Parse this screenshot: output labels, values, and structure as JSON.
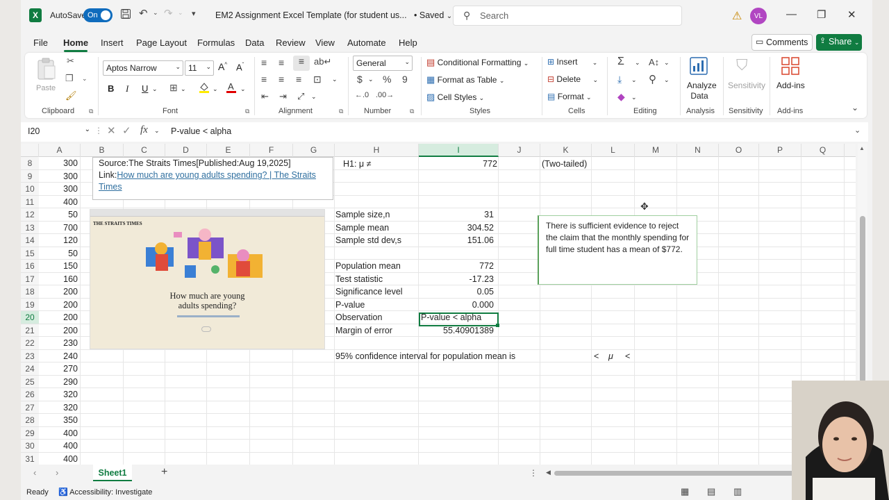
{
  "title_bar": {
    "autosave_label": "AutoSave",
    "autosave_state": "On",
    "doc_title": "EM2 Assignment Excel Template (for student us...",
    "saved_status": "• Saved",
    "search_placeholder": "Search",
    "avatar_initials": "VL"
  },
  "menu": {
    "tabs": [
      "File",
      "Home",
      "Insert",
      "Page Layout",
      "Formulas",
      "Data",
      "Review",
      "View",
      "Automate",
      "Help"
    ],
    "active_tab": "Home",
    "comments_label": "Comments",
    "share_label": "Share"
  },
  "ribbon": {
    "clipboard": {
      "paste": "Paste",
      "label": "Clipboard"
    },
    "font": {
      "name": "Aptos Narrow",
      "size": "11",
      "label": "Font"
    },
    "alignment": {
      "label": "Alignment"
    },
    "number": {
      "format": "General",
      "label": "Number"
    },
    "styles": {
      "conditional": "Conditional Formatting",
      "table": "Format as Table",
      "cell_styles": "Cell Styles",
      "label": "Styles"
    },
    "cells": {
      "insert": "Insert",
      "delete": "Delete",
      "format": "Format",
      "label": "Cells"
    },
    "editing": {
      "label": "Editing"
    },
    "analysis": {
      "button": "Analyze Data",
      "button_l1": "Analyze",
      "button_l2": "Data",
      "label": "Analysis"
    },
    "sensitivity": {
      "button": "Sensitivity",
      "label": "Sensitivity"
    },
    "addins": {
      "button": "Add-ins",
      "label": "Add-ins"
    }
  },
  "formula_bar": {
    "name_box": "I20",
    "formula": "P-value  <  alpha"
  },
  "grid": {
    "columns": [
      "A",
      "B",
      "C",
      "D",
      "E",
      "F",
      "G",
      "H",
      "I",
      "J",
      "K",
      "L",
      "M",
      "N",
      "O",
      "P",
      "Q"
    ],
    "selected_column": "I",
    "rows": [
      "8",
      "9",
      "10",
      "11",
      "12",
      "13",
      "14",
      "15",
      "16",
      "17",
      "18",
      "19",
      "20",
      "21",
      "22",
      "23",
      "24",
      "25",
      "26",
      "27",
      "28",
      "29",
      "30",
      "31"
    ],
    "selected_row": "20",
    "col_a_values": [
      "300",
      "300",
      "300",
      "400",
      "50",
      "700",
      "120",
      "50",
      "150",
      "160",
      "200",
      "200",
      "200",
      "200",
      "230",
      "240",
      "270",
      "290",
      "320",
      "320",
      "350",
      "400",
      "400",
      "400"
    ],
    "source_line": "Source:The Straits Times[Published:Aug 19,2025]",
    "link_prefix": "Link:",
    "link_text_1": "How much are young adults spending? | The Straits",
    "link_text_2": "Times",
    "image_masthead": "THE STRAITS TIMES",
    "image_headline_1": "How much are young",
    "image_headline_2": "adults spending?",
    "h1_label": "H1: μ ≠",
    "h1_value": "772",
    "two_tailed": "(Two-tailed)",
    "stats": [
      {
        "label": "Sample size,n",
        "value": "31"
      },
      {
        "label": "Sample mean",
        "value": "304.52"
      },
      {
        "label": "Sample std dev,s",
        "value": "151.06"
      },
      {
        "label": "",
        "value": ""
      },
      {
        "label": "Population mean",
        "value": "772"
      },
      {
        "label": "Test statistic",
        "value": "-17.23"
      },
      {
        "label": "Significance level",
        "value": "0.05"
      },
      {
        "label": "P-value",
        "value": "0.000"
      },
      {
        "label": "Observation",
        "value": "P-value  <  alpha"
      },
      {
        "label": "Margin of error",
        "value": "55.40901389"
      }
    ],
    "ci_label": "95% confidence interval for population mean is",
    "ci_lt1": "<",
    "ci_mu": "μ",
    "ci_lt2": "<",
    "conclusion": "There is sufficient evidence to reject the claim that the  monthly spending for full time student has a mean of $772."
  },
  "sheets": {
    "active": "Sheet1",
    "add": "+"
  },
  "status": {
    "ready": "Ready",
    "accessibility": "Accessibility: Investigate"
  },
  "colors": {
    "excel_green": "#107c41",
    "toggle_blue": "#0f6cbd",
    "link_blue": "#2f6f9f"
  }
}
